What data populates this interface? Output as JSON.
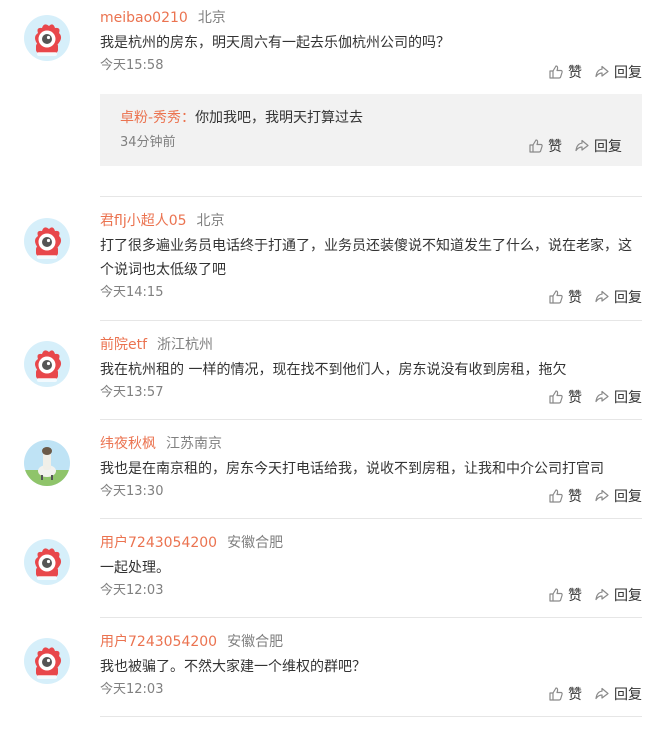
{
  "comments": [
    {
      "username": "meibao0210",
      "location": "北京",
      "text": "我是杭州的房东，明天周六有一起去乐伽杭州公司的吗？",
      "time": "今天15:58",
      "like_label": "赞",
      "reply_label": "回复",
      "reply": {
        "username": "卓粉-秀秀：",
        "text": "你加我吧，我明天打算过去",
        "time": "34分钟前",
        "like_label": "赞",
        "reply_label": "回复"
      }
    },
    {
      "username": "君flj小超人05",
      "location": "北京",
      "text": "打了很多遍业务员电话终于打通了，业务员还装傻说不知道发生了什么，说在老家，这个说词也太低级了吧",
      "time": "今天14:15",
      "like_label": "赞",
      "reply_label": "回复"
    },
    {
      "username": "前院etf",
      "location": "浙江杭州",
      "text": "我在杭州租的 一样的情况，现在找不到他们人，房东说没有收到房租，拖欠",
      "time": "今天13:57",
      "like_label": "赞",
      "reply_label": "回复"
    },
    {
      "username": "纬夜秋枫",
      "location": "江苏南京",
      "text": "我也是在南京租的，房东今天打电话给我，说收不到房租，让我和中介公司打官司",
      "time": "今天13:30",
      "like_label": "赞",
      "reply_label": "回复"
    },
    {
      "username": "用户7243054200",
      "location": "安徽合肥",
      "text": "一起处理。",
      "time": "今天12:03",
      "like_label": "赞",
      "reply_label": "回复"
    },
    {
      "username": "用户7243054200",
      "location": "安徽合肥",
      "text": "我也被骗了。不然大家建一个维权的群吧？",
      "time": "今天12:03",
      "like_label": "赞",
      "reply_label": "回复"
    }
  ],
  "colors": {
    "username": "#eb7350",
    "meta_gray": "#808080",
    "reply_bg": "#f2f2f2",
    "avatar_bg": "#d6effa",
    "avatar_red": "#e8474b"
  },
  "icons": {
    "like": "thumbs-up-icon",
    "reply": "reply-arrow-icon",
    "default_avatar": "weibo-eye-avatar",
    "photo_avatar": "sheep-photo-avatar"
  }
}
